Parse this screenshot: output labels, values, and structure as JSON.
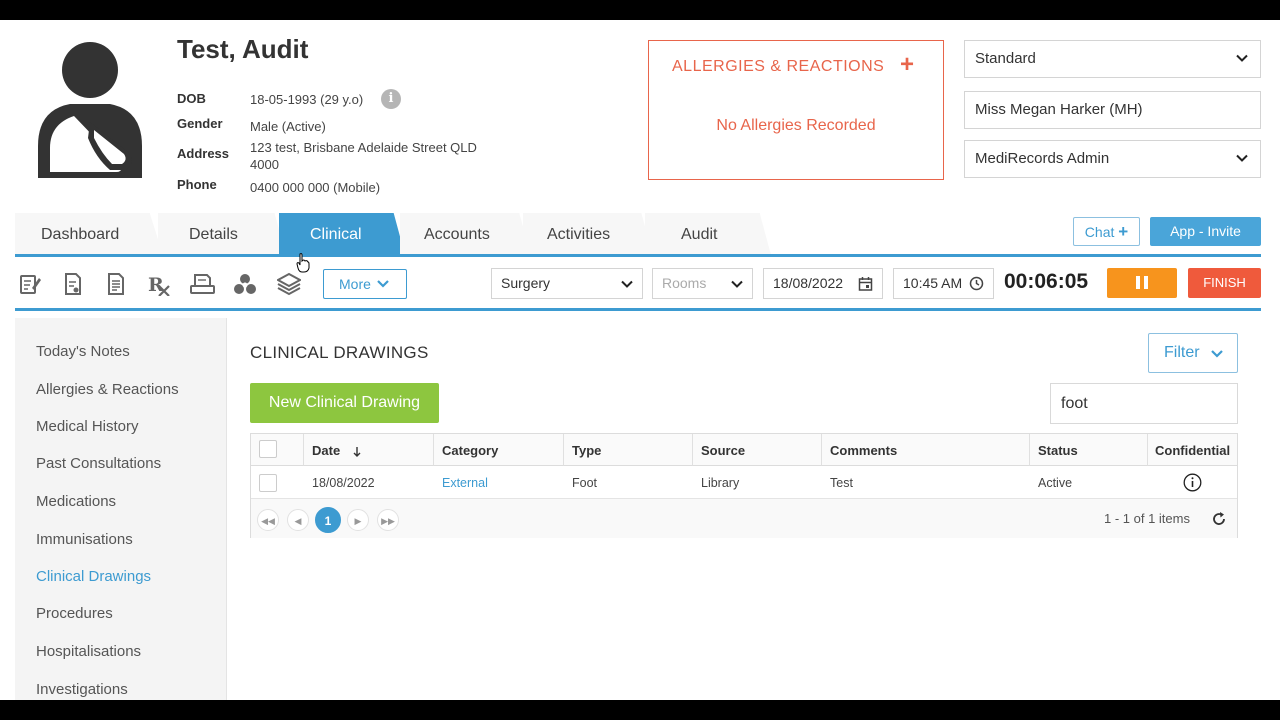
{
  "patient": {
    "name": "Test, Audit",
    "dob_label": "DOB",
    "dob": "18-05-1993 (29 y.o)",
    "gender_label": "Gender",
    "gender": "Male (Active)",
    "address_label": "Address",
    "address_line1": "123 test, Brisbane Adelaide Street QLD",
    "address_line2": "4000",
    "phone_label": "Phone",
    "phone": "0400 000 000 (Mobile)"
  },
  "allergies": {
    "title": "ALLERGIES & REACTIONS",
    "add": "+",
    "empty": "No Allergies Recorded"
  },
  "selectors": {
    "mode": "Standard",
    "practitioner": "Miss Megan Harker (MH)",
    "role": "MediRecords Admin"
  },
  "tabs": [
    {
      "label": "Dashboard"
    },
    {
      "label": "Details"
    },
    {
      "label": "Clinical"
    },
    {
      "label": "Accounts"
    },
    {
      "label": "Activities"
    },
    {
      "label": "Audit"
    }
  ],
  "actions": {
    "chat": "Chat",
    "app_invite": "App - Invite"
  },
  "toolbar": {
    "icons": [
      "notes-icon",
      "document-icon",
      "letter-icon",
      "prescription-icon",
      "scanner-icon",
      "biohazard-icon",
      "layers-icon"
    ],
    "more": "More",
    "location": "Surgery",
    "rooms_placeholder": "Rooms",
    "date": "18/08/2022",
    "time": "10:45 AM",
    "timer": "00:06:05",
    "finish": "FINISH"
  },
  "sidebar": {
    "items": [
      {
        "label": "Today's Notes"
      },
      {
        "label": "Allergies & Reactions"
      },
      {
        "label": "Medical History"
      },
      {
        "label": "Past Consultations"
      },
      {
        "label": "Medications"
      },
      {
        "label": "Immunisations"
      },
      {
        "label": "Clinical Drawings"
      },
      {
        "label": "Procedures"
      },
      {
        "label": "Hospitalisations"
      },
      {
        "label": "Investigations"
      }
    ],
    "active": "Clinical Drawings"
  },
  "main": {
    "title": "CLINICAL DRAWINGS",
    "filter": "Filter",
    "new_button": "New Clinical Drawing",
    "search_value": "foot"
  },
  "grid": {
    "columns": [
      "Date",
      "Category",
      "Type",
      "Source",
      "Comments",
      "Status",
      "Confidential"
    ],
    "rows": [
      {
        "date": "18/08/2022",
        "category": "External",
        "type": "Foot",
        "source": "Library",
        "comments": "Test",
        "status": "Active"
      }
    ],
    "current_page": "1",
    "page_info": "1 - 1 of 1 items"
  },
  "colors": {
    "accent": "#3d9bd1",
    "allergy": "#e8654b",
    "pause": "#f7941d",
    "finish": "#ef5a3c",
    "new": "#8dc63f"
  }
}
